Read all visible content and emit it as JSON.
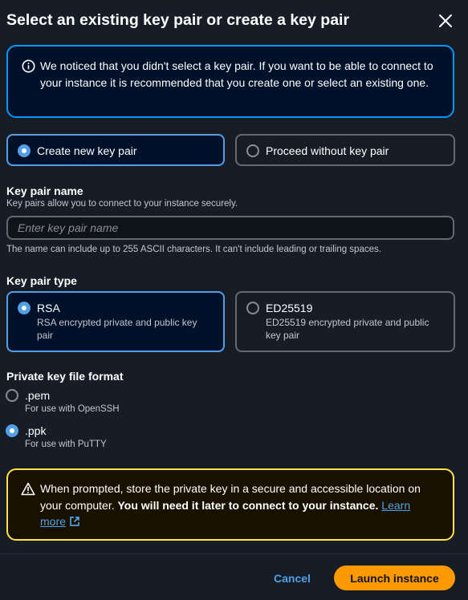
{
  "modal": {
    "title": "Select an existing key pair or create a key pair",
    "close_icon": "close-icon"
  },
  "info_alert": {
    "icon": "info-icon",
    "text": "We noticed that you didn't select a key pair. If you want to be able to connect to your instance it is recommended that you create one or select an existing one."
  },
  "key_pair_choice": {
    "options": [
      {
        "label": "Create new key pair",
        "selected": true
      },
      {
        "label": "Proceed without key pair",
        "selected": false
      }
    ]
  },
  "key_pair_name": {
    "label": "Key pair name",
    "description": "Key pairs allow you to connect to your instance securely.",
    "value": "",
    "placeholder": "Enter key pair name",
    "constraint": "The name can include up to 255 ASCII characters. It can't include leading or trailing spaces."
  },
  "key_pair_type": {
    "label": "Key pair type",
    "options": [
      {
        "label": "RSA",
        "description": "RSA encrypted private and public key pair",
        "selected": true
      },
      {
        "label": "ED25519",
        "description": "ED25519 encrypted private and public key pair",
        "selected": false
      }
    ]
  },
  "file_format": {
    "label": "Private key file format",
    "options": [
      {
        "label": ".pem",
        "description": "For use with OpenSSH",
        "selected": false
      },
      {
        "label": ".ppk",
        "description": "For use with PuTTY",
        "selected": true
      }
    ]
  },
  "warning_alert": {
    "icon": "warning-icon",
    "text": "When prompted, store the private key in a secure and accessible location on your computer.",
    "bold_text": "You will need it later to connect to your instance.",
    "link_text": "Learn more",
    "link_icon": "external-link-icon"
  },
  "footer": {
    "cancel_label": "Cancel",
    "launch_label": "Launch instance"
  },
  "colors": {
    "background": "#161d26",
    "info_border": "#0099ff",
    "selected_border": "#539fe5",
    "warning_border": "#ffe347",
    "primary_button": "#ff9900",
    "link": "#539fe5"
  }
}
